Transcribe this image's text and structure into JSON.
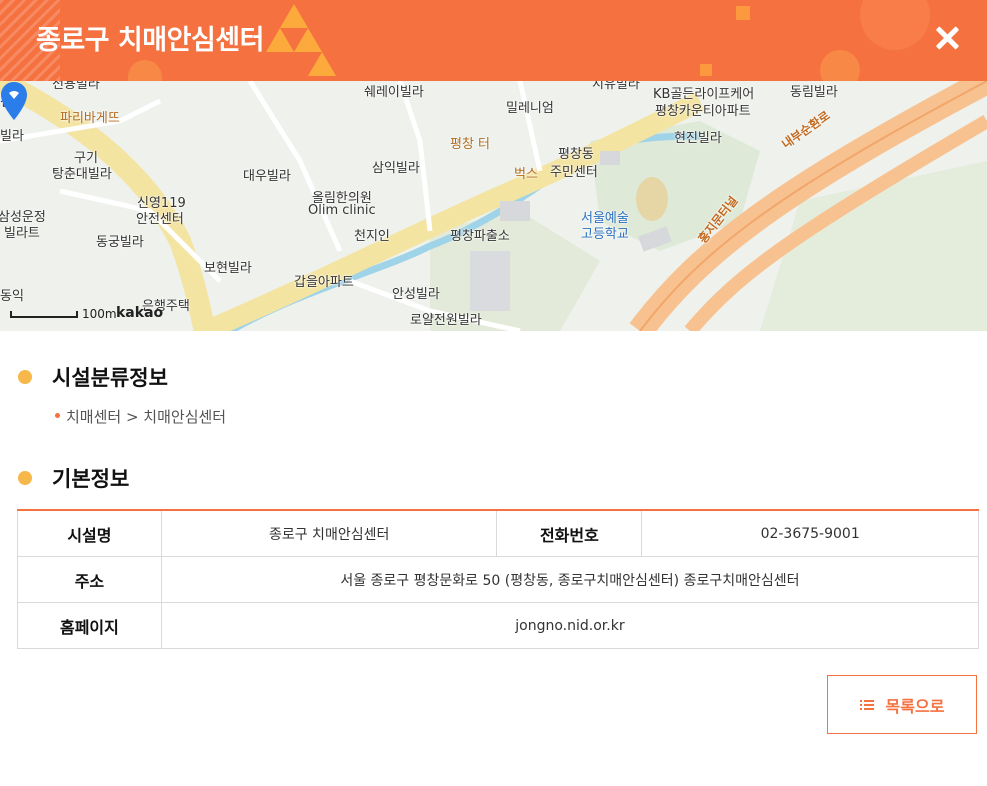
{
  "header": {
    "title": "종로구 치매안심센터"
  },
  "map": {
    "labels": [
      "쉐레이빌라",
      "밀레니엄",
      "KB골든라이프케어",
      "평창카운티아파트",
      "동림빌라",
      "현진빌라",
      "파리바게뜨",
      "구기",
      "탕춘대빌라",
      "평창 터",
      "평창동",
      "주민센터",
      "벅스",
      "대우빌라",
      "삼익빌라",
      "올림한의원",
      "Olim clinic",
      "신영119",
      "안전센터",
      "삼성운정",
      "빌라트",
      "동궁빌라",
      "천지인",
      "평창파출소",
      "서울예술",
      "고등학교",
      "보현빌라",
      "갑을아파트",
      "은행주택",
      "안성빌라",
      "로얄전원빌라",
      "내부순환로",
      "홍지문터널",
      "빌라",
      "센터",
      "전용빌라",
      "지유빌라",
      "동익"
    ],
    "scale_text": "100m",
    "brand": "kakao"
  },
  "category_section": {
    "title": "시설분류정보",
    "path": "치매센터 > 치매안심센터"
  },
  "basic_section": {
    "title": "기본정보"
  },
  "table": {
    "facility_name_label": "시설명",
    "facility_name_value": "종로구 치매안심센터",
    "phone_label": "전화번호",
    "phone_value": "02-3675-9001",
    "address_label": "주소",
    "address_value": "서울 종로구 평창문화로 50 (평창동, 종로구치매안심센터) 종로구치매안심센터",
    "homepage_label": "홈페이지",
    "homepage_value": "jongno.nid.or.kr"
  },
  "buttons": {
    "list_label": "목록으로"
  },
  "colors": {
    "accent": "#f57140",
    "dot": "#f6b84a"
  }
}
